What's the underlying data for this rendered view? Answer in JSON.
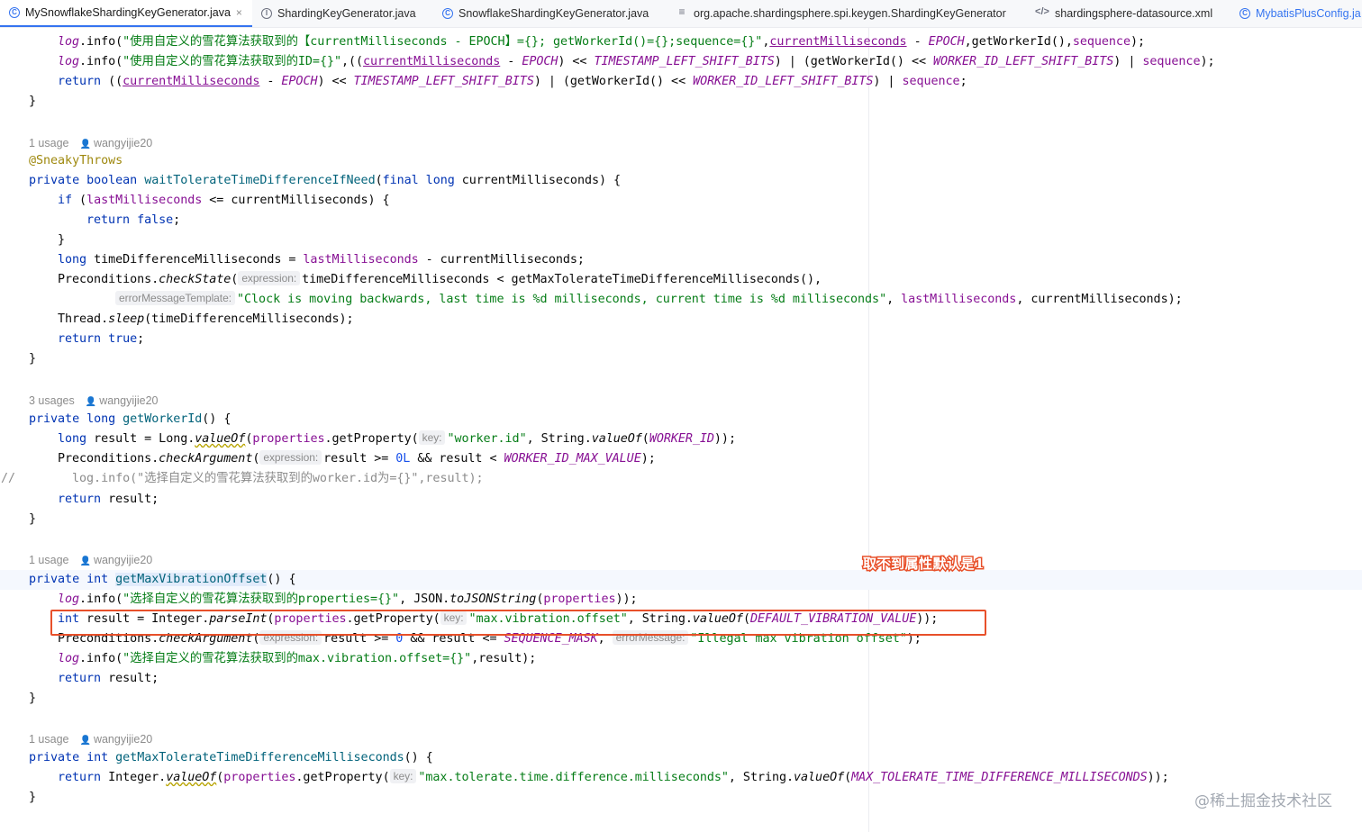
{
  "tabs": [
    {
      "label": "MySnowflakeShardingKeyGenerator.java",
      "icon": "class-icon",
      "active": true,
      "closable": true
    },
    {
      "label": "ShardingKeyGenerator.java",
      "icon": "interface-icon"
    },
    {
      "label": "SnowflakeShardingKeyGenerator.java",
      "icon": "class-icon"
    },
    {
      "label": "org.apache.shardingsphere.spi.keygen.ShardingKeyGenerator",
      "icon": "text-file-icon"
    },
    {
      "label": "shardingsphere-datasource.xml",
      "icon": "xml-file-icon"
    },
    {
      "label": "MybatisPlusConfig.ja",
      "icon": "class-icon"
    }
  ],
  "tab_close_glyph": "×",
  "code": {
    "m1": {
      "l1": {
        "t1": "log",
        "t2": ".info(",
        "t3": "\"使用自定义的雪花算法获取到的【currentMilliseconds - EPOCH】={}; getWorkerId()={};sequence={}\"",
        "t4": ",",
        "t5": "currentMilliseconds",
        "t6": " - ",
        "t7": "EPOCH",
        "t8": ",getWorkerId(),",
        "t9": "sequence",
        "t10": ");"
      },
      "l2": {
        "t1": "log",
        "t2": ".info(",
        "t3": "\"使用自定义的雪花算法获取到的ID={}\"",
        "t4": ",((",
        "t5": "currentMilliseconds",
        "t6": " - ",
        "t7": "EPOCH",
        "t8": ") << ",
        "t9": "TIMESTAMP_LEFT_SHIFT_BITS",
        "t10": ") | (getWorkerId() << ",
        "t11": "WORKER_ID_LEFT_SHIFT_BITS",
        "t12": ") | ",
        "t13": "sequence",
        "t14": ");"
      },
      "l3": {
        "t1": "return",
        "t2": " ((",
        "t3": "currentMilliseconds",
        "t4": " - ",
        "t5": "EPOCH",
        "t6": ") << ",
        "t7": "TIMESTAMP_LEFT_SHIFT_BITS",
        "t8": ") | (getWorkerId() << ",
        "t9": "WORKER_ID_LEFT_SHIFT_BITS",
        "t10": ") | ",
        "t11": "sequence",
        "t12": ";"
      },
      "close": "}"
    },
    "m2": {
      "usages": "1 usage",
      "author": "wangyijie20",
      "annotation": "@SneakyThrows",
      "sig": {
        "t1": "private boolean ",
        "t2": "waitTolerateTimeDifferenceIfNeed",
        "t3": "(",
        "t4": "final long ",
        "t5": "currentMilliseconds) {"
      },
      "l1": {
        "t1": "if",
        "t2": " (",
        "t3": "lastMilliseconds",
        "t4": " <= currentMilliseconds) {"
      },
      "l2": {
        "t1": "return false",
        "t2": ";"
      },
      "l3": "}",
      "l4": {
        "t1": "long",
        "t2": " timeDifferenceMilliseconds = ",
        "t3": "lastMilliseconds",
        "t4": " - currentMilliseconds;"
      },
      "l5": {
        "t1": "Preconditions.",
        "t2": "checkState",
        "t3": "(",
        "hint": "expression:",
        "t4": "timeDifferenceMilliseconds < getMaxTolerateTimeDifferenceMilliseconds(),"
      },
      "l6": {
        "hint": "errorMessageTemplate:",
        "t1": "\"Clock is moving backwards, last time is %d milliseconds, current time is %d milliseconds\"",
        "t2": ", ",
        "t3": "lastMilliseconds",
        "t4": ", currentMilliseconds);"
      },
      "l7": {
        "t1": "Thread.",
        "t2": "sleep",
        "t3": "(timeDifferenceMilliseconds);"
      },
      "l8": {
        "t1": "return true",
        "t2": ";"
      },
      "close": "}"
    },
    "m3": {
      "usages": "3 usages",
      "author": "wangyijie20",
      "sig": {
        "t1": "private long ",
        "t2": "getWorkerId",
        "t3": "() {"
      },
      "l1": {
        "t1": "long",
        "t2": " result = Long.",
        "t3": "valueOf",
        "t4": "(",
        "t5": "properties",
        "t6": ".getProperty(",
        "hint": "key:",
        "t7": "\"worker.id\"",
        "t8": ", String.",
        "t9": "valueOf",
        "t10": "(",
        "t11": "WORKER_ID",
        "t12": "));"
      },
      "l2": {
        "t1": "Preconditions.",
        "t2": "checkArgument",
        "t3": "(",
        "hint": "expression:",
        "t4": "result >= ",
        "t5": "0L",
        "t6": " && result < ",
        "t7": "WORKER_ID_MAX_VALUE",
        "t8": ");"
      },
      "l3": {
        "gutter": "//",
        "t1": "  log.info(\"选择自定义的雪花算法获取到的worker.id为={}\",result);"
      },
      "l4": {
        "t1": "return",
        "t2": " result;"
      },
      "close": "}"
    },
    "m4": {
      "usages": "1 usage",
      "author": "wangyijie20",
      "sig": {
        "t1": "private int ",
        "t2": "getMaxVibrationOffset",
        "t3": "() {"
      },
      "l1": {
        "t1": "log",
        "t2": ".info(",
        "t3": "\"选择自定义的雪花算法获取到的properties={}\"",
        "t4": ", JSON.",
        "t5": "toJSONString",
        "t6": "(",
        "t7": "properties",
        "t8": "));"
      },
      "l2": {
        "t1": "int",
        "t2": " result = Integer.",
        "t3": "parseInt",
        "t4": "(",
        "t5": "properties",
        "t6": ".getProperty(",
        "hint": "key:",
        "t7": "\"max.vibration.offset\"",
        "t8": ", String.",
        "t9": "valueOf",
        "t10": "(",
        "t11": "DEFAULT_VIBRATION_VALUE",
        "t12": "));"
      },
      "l3": {
        "t1": "Preconditions.",
        "t2": "checkArgument",
        "t3": "(",
        "hint": "expression:",
        "t4": "result >= ",
        "t5": "0",
        "t6": " && result <= ",
        "t7": "SEQUENCE_MASK",
        "t8": ", ",
        "hint2": "errorMessage:",
        "t9": "\"Illegal max vibration offset\"",
        "t10": ");"
      },
      "l4": {
        "t1": "log",
        "t2": ".info(",
        "t3": "\"选择自定义的雪花算法获取到的max.vibration.offset={}\"",
        "t4": ",result);"
      },
      "l5": {
        "t1": "return",
        "t2": " result;"
      },
      "close": "}"
    },
    "m5": {
      "usages": "1 usage",
      "author": "wangyijie20",
      "sig": {
        "t1": "private int ",
        "t2": "getMaxTolerateTimeDifferenceMilliseconds",
        "t3": "() {"
      },
      "l1": {
        "t1": "return",
        "t2": " Integer.",
        "t3": "valueOf",
        "t4": "(",
        "t5": "properties",
        "t6": ".getProperty(",
        "hint": "key:",
        "t7": "\"max.tolerate.time.difference.milliseconds\"",
        "t8": ", String.",
        "t9": "valueOf",
        "t10": "(",
        "t11": "MAX_TOLERATE_TIME_DIFFERENCE_MILLISECONDS",
        "t12": "));"
      },
      "close": "}"
    }
  },
  "annotation_note": "取不到属性默认是1",
  "watermark": "@稀土掘金技术社区",
  "colors": {
    "keyword": "#0033b3",
    "string": "#067d17",
    "field": "#871094",
    "method_decl": "#00627a",
    "number": "#1750eb",
    "annotation": "#9e880d",
    "highlight_box": "#e8502a",
    "tab_accent": "#3574f0"
  }
}
